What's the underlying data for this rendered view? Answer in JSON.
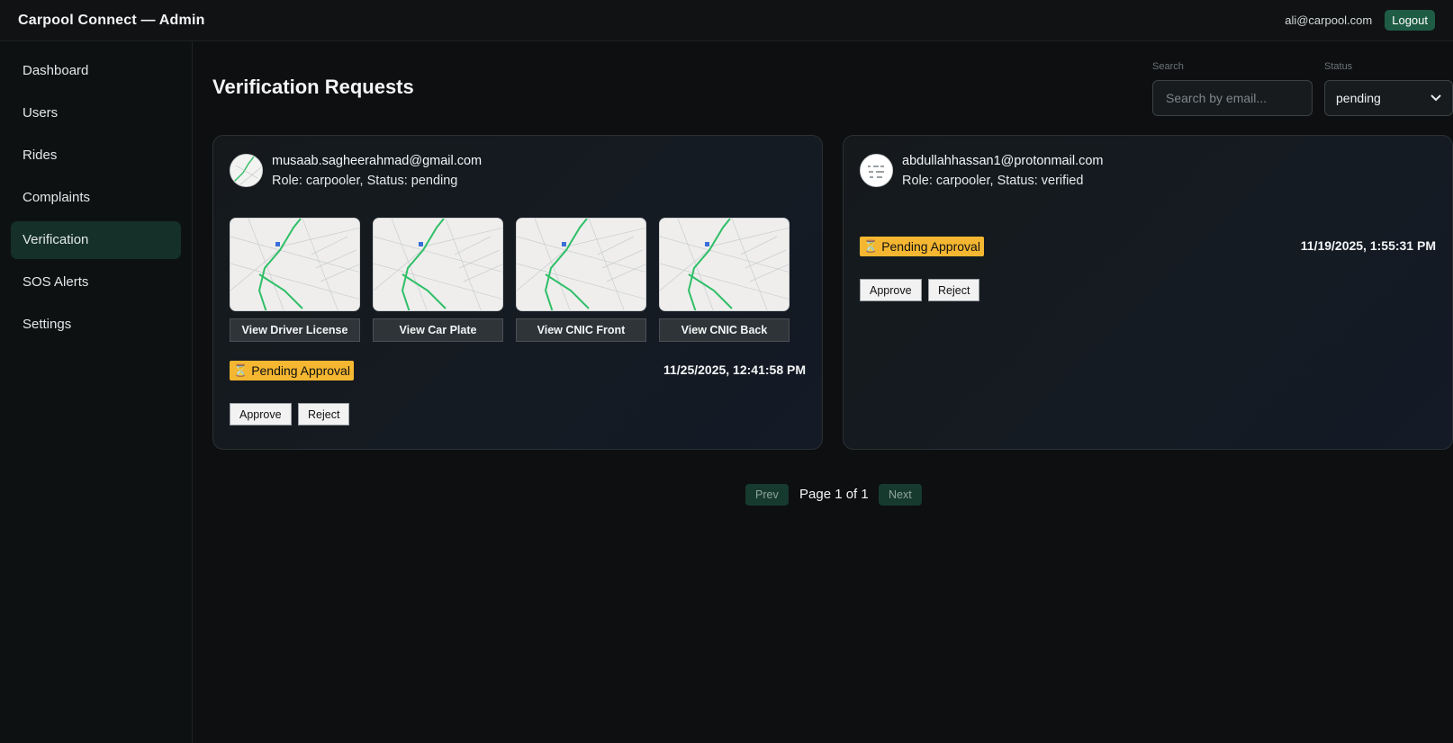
{
  "app": {
    "title": "Carpool Connect — Admin",
    "user_email": "ali@carpool.com",
    "logout_label": "Logout"
  },
  "sidebar": {
    "items": [
      {
        "label": "Dashboard"
      },
      {
        "label": "Users"
      },
      {
        "label": "Rides"
      },
      {
        "label": "Complaints"
      },
      {
        "label": "Verification",
        "active": true
      },
      {
        "label": "SOS Alerts"
      },
      {
        "label": "Settings"
      }
    ]
  },
  "main": {
    "title": "Verification Requests",
    "filters": {
      "search_label": "Search",
      "search_placeholder": "Search by email...",
      "status_label": "Status",
      "status_value": "pending"
    },
    "requests": [
      {
        "email": "musaab.sagheerahmad@gmail.com",
        "role_status": "Role: carpooler, Status: pending",
        "documents": [
          {
            "label": "View Driver License"
          },
          {
            "label": "View Car Plate"
          },
          {
            "label": "View CNIC Front"
          },
          {
            "label": "View CNIC Back"
          }
        ],
        "badge": "Pending Approval",
        "badge_icon": "⏳",
        "date": "11/25/2025, 12:41:58 PM",
        "approve_label": "Approve",
        "reject_label": "Reject"
      },
      {
        "email": "abdullahhassan1@protonmail.com",
        "role_status": "Role: carpooler, Status: verified",
        "documents": [],
        "badge": "Pending Approval",
        "badge_icon": "⏳",
        "date": "11/19/2025, 1:55:31 PM",
        "approve_label": "Approve",
        "reject_label": "Reject"
      }
    ],
    "pagination": {
      "prev_label": "Prev",
      "page_info": "Page 1 of 1",
      "next_label": "Next"
    }
  },
  "colors": {
    "accent": "#1f5c46",
    "active_nav": "#143029",
    "badge": "#f5b731",
    "background": "#0d0f10"
  }
}
